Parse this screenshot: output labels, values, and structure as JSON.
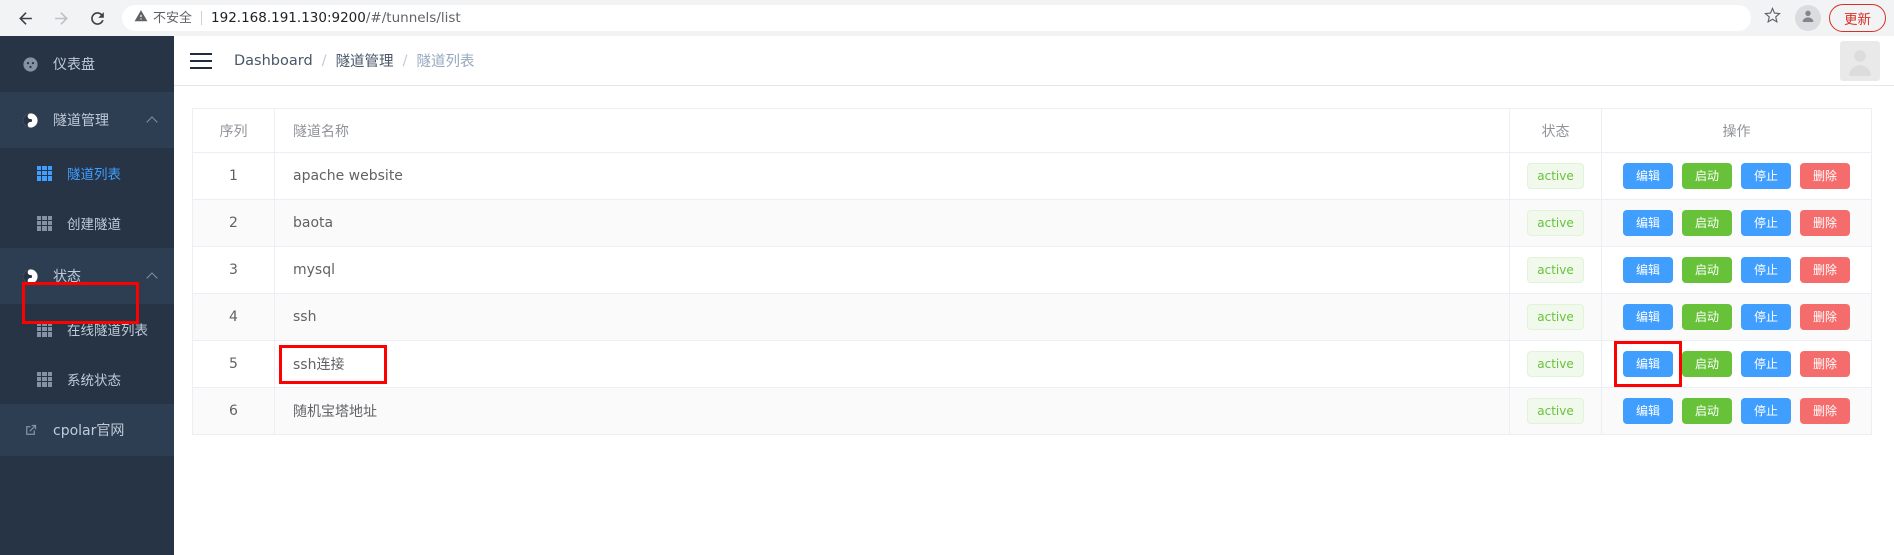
{
  "browser": {
    "back_icon": "back-arrow-icon",
    "forward_icon": "forward-arrow-icon",
    "reload_icon": "reload-icon",
    "security_icon": "warning-triangle-icon",
    "security_label": "不安全",
    "url": "192.168.191.130:9200/#/tunnels/list",
    "url_host": "192.168.191.130:9200",
    "url_path": "/#/tunnels/list",
    "bookmark_icon": "star-icon",
    "profile_icon": "profile-avatar-icon",
    "update_label": "更新"
  },
  "sidebar": {
    "items": [
      {
        "label": "仪表盘",
        "icon": "dashboard-icon",
        "type": "group",
        "name": "sidebar-item-dashboard"
      },
      {
        "label": "隧道管理",
        "icon": "tunnel-icon",
        "type": "group",
        "name": "sidebar-item-tunnel-manage",
        "expanded": true
      },
      {
        "label": "隧道列表",
        "icon": "grid-icon",
        "type": "sub",
        "name": "sidebar-item-tunnel-list",
        "active": true
      },
      {
        "label": "创建隧道",
        "icon": "grid-icon",
        "type": "sub",
        "name": "sidebar-item-create-tunnel"
      },
      {
        "label": "状态",
        "icon": "status-icon",
        "type": "group",
        "name": "sidebar-item-status",
        "expanded": true
      },
      {
        "label": "在线隧道列表",
        "icon": "grid-icon",
        "type": "sub",
        "name": "sidebar-item-online-tunnel-list"
      },
      {
        "label": "系统状态",
        "icon": "grid-icon",
        "type": "sub",
        "name": "sidebar-item-system-status"
      },
      {
        "label": "cpolar官网",
        "icon": "external-link-icon",
        "type": "link",
        "name": "sidebar-item-cpolar-website"
      }
    ]
  },
  "topbar": {
    "menu_icon": "hamburger-menu-icon",
    "breadcrumb": [
      "Dashboard",
      "隧道管理",
      "隧道列表"
    ],
    "separator": "/",
    "avatar_icon": "user-avatar-icon"
  },
  "table": {
    "columns": [
      "序列",
      "隧道名称",
      "状态",
      "操作"
    ],
    "rows": [
      {
        "seq": "1",
        "name": "apache website",
        "status": "active"
      },
      {
        "seq": "2",
        "name": "baota",
        "status": "active"
      },
      {
        "seq": "3",
        "name": "mysql",
        "status": "active"
      },
      {
        "seq": "4",
        "name": "ssh",
        "status": "active"
      },
      {
        "seq": "5",
        "name": "ssh连接",
        "status": "active"
      },
      {
        "seq": "6",
        "name": "随机宝塔地址",
        "status": "active"
      }
    ],
    "actions": [
      {
        "label": "编辑",
        "color": "blue",
        "name": "edit-button"
      },
      {
        "label": "启动",
        "color": "green",
        "name": "start-button"
      },
      {
        "label": "停止",
        "color": "blue",
        "name": "stop-button"
      },
      {
        "label": "删除",
        "color": "red",
        "name": "delete-button"
      }
    ]
  },
  "colors": {
    "sidebar_bg": "#263445",
    "sidebar_bg_light": "#2e3e52",
    "accent_blue": "#409eff",
    "success_green": "#67c23a",
    "danger_red": "#f56c6c",
    "highlight_red": "#ff0000",
    "badge_bg": "#f0f9eb",
    "update_red": "#d93025"
  },
  "annotations": [
    {
      "name": "highlight-tunnel-list-nav",
      "target": "sidebar-item-tunnel-list"
    },
    {
      "name": "highlight-row5-name",
      "target": "row-5-name-cell"
    },
    {
      "name": "highlight-row5-edit",
      "target": "row-5-edit-button"
    }
  ]
}
